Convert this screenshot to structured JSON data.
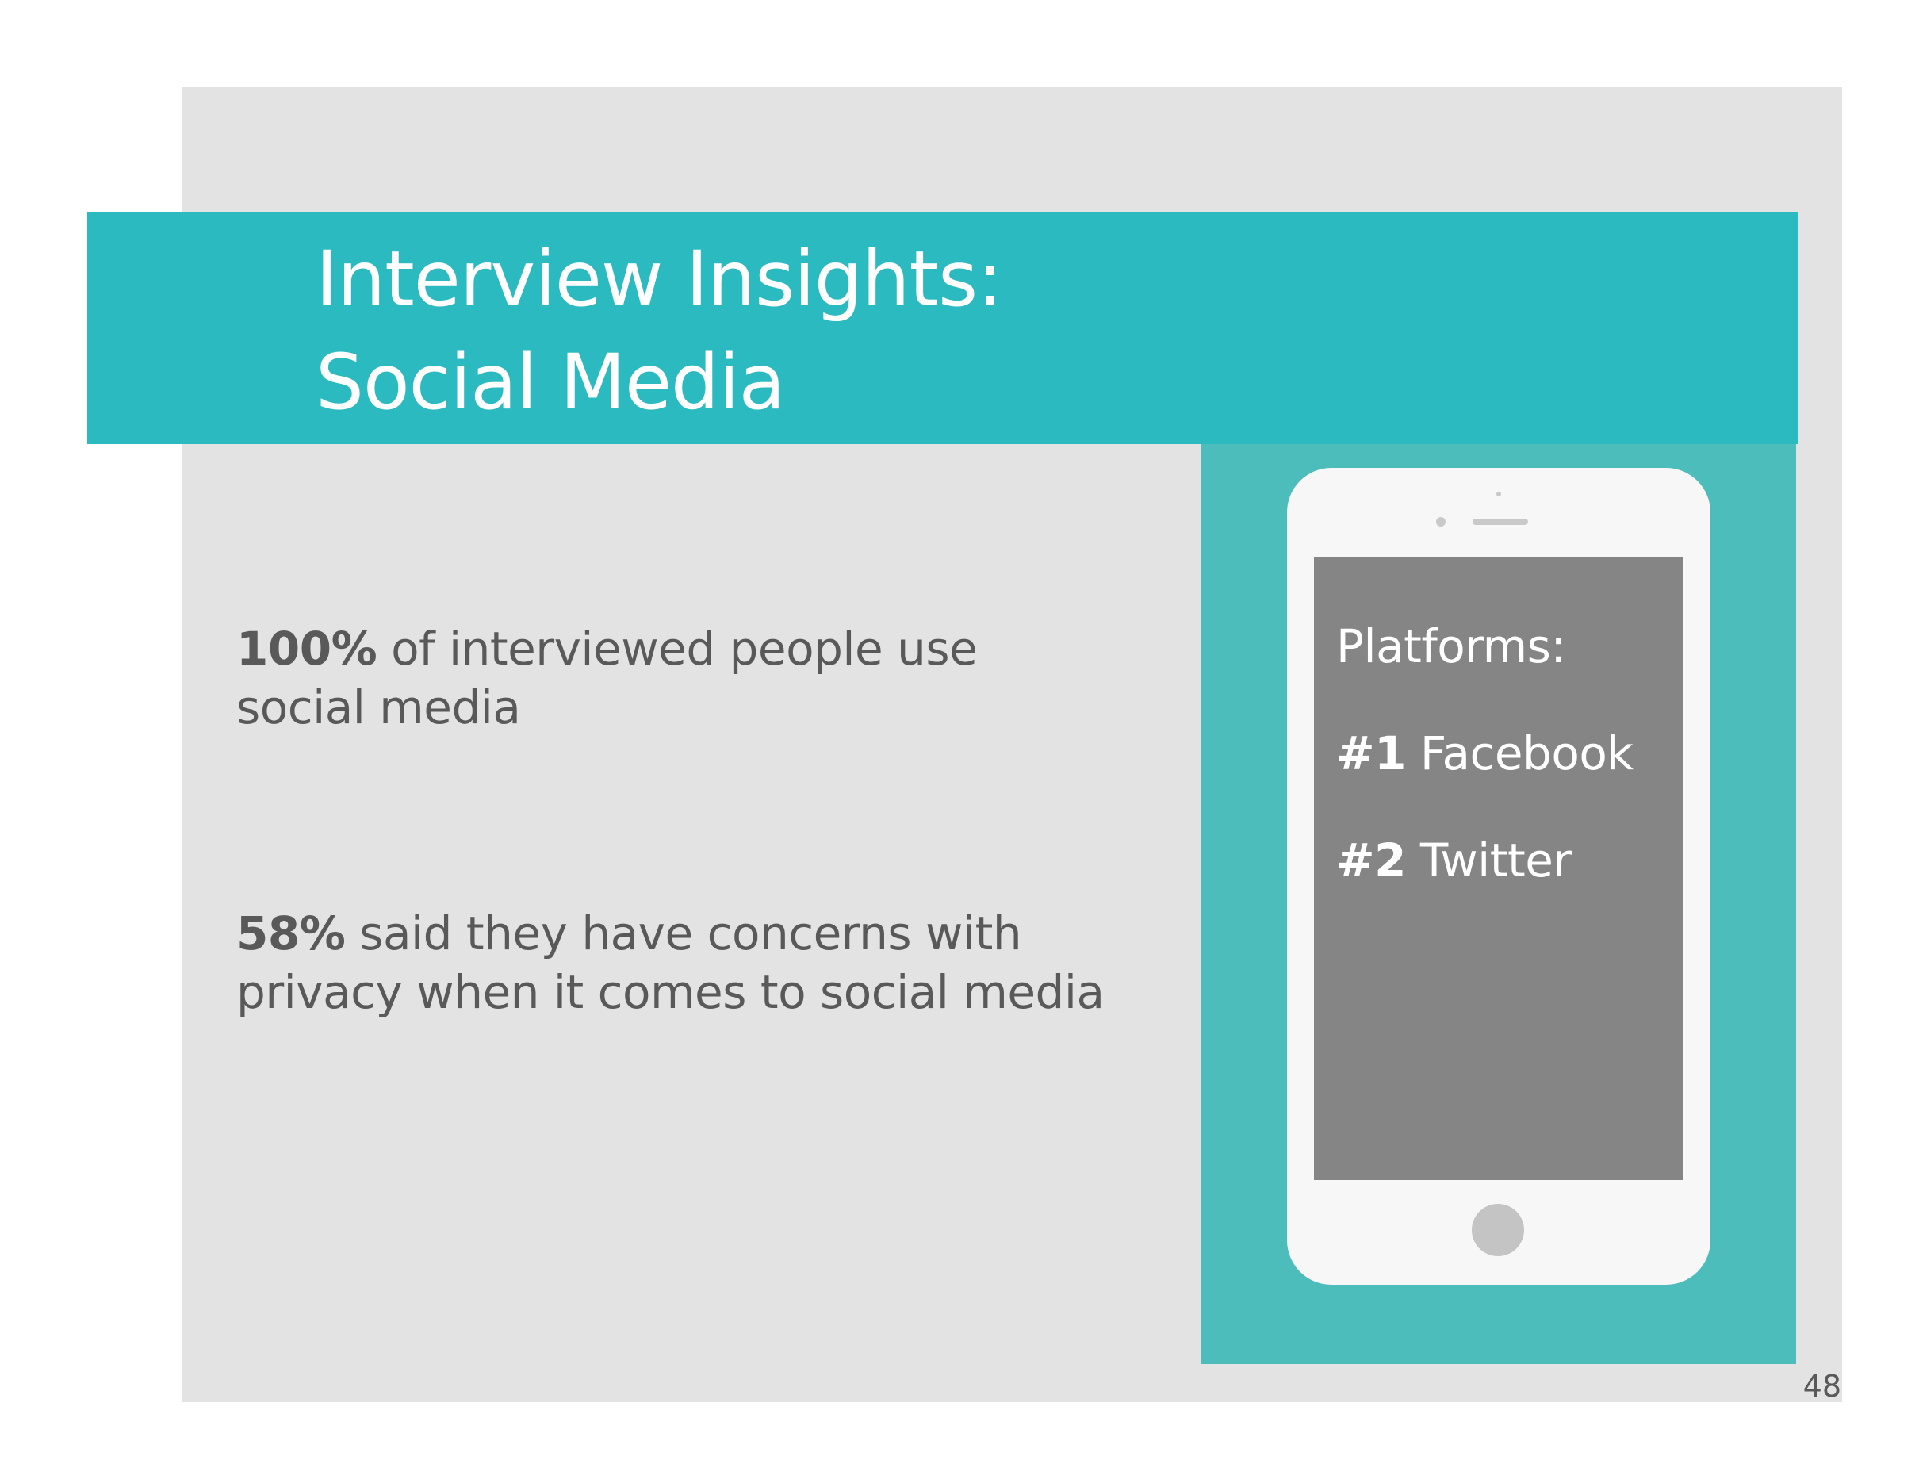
{
  "title": {
    "line1": "Interview Insights:",
    "line2": "Social Media"
  },
  "stats": [
    {
      "value": "100%",
      "text": " of interviewed people use social media"
    },
    {
      "value": "58%",
      "text": " said they have concerns with privacy when it comes to social media"
    }
  ],
  "phone": {
    "heading": "Platforms:",
    "platforms": [
      {
        "rank": "#1",
        "name": " Facebook"
      },
      {
        "rank": "#2",
        "name": " Twitter"
      }
    ]
  },
  "page_number": "48",
  "colors": {
    "title_band": "#2abac0",
    "phone_panel": "#4dbdbc",
    "slide_background": "#e3e3e3",
    "phone_screen": "#858585",
    "body_text": "#595959"
  }
}
